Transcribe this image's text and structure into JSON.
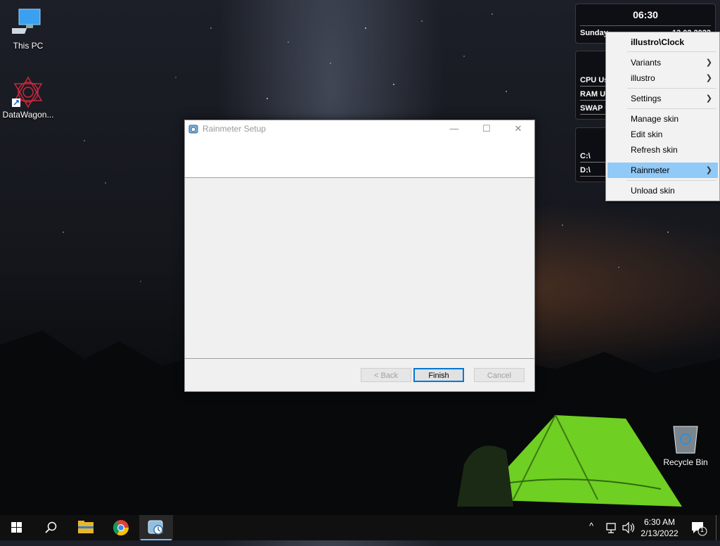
{
  "desktop": {
    "icons": [
      {
        "label": "This PC"
      },
      {
        "label": "DataWagon..."
      },
      {
        "label": "Recycle Bin"
      }
    ]
  },
  "widgets": {
    "clock": {
      "time": "06:30",
      "day": "Sunday",
      "date": "13.02.2022"
    },
    "system": {
      "rows": [
        "CPU Us",
        "RAM Us",
        "SWAP U"
      ]
    },
    "disks": {
      "rows": [
        "C:\\",
        "D:\\"
      ]
    }
  },
  "context_menu": {
    "header": "illustro\\Clock",
    "items": {
      "variants": "Variants",
      "illustro": "illustro",
      "settings": "Settings",
      "manage_skin": "Manage skin",
      "edit_skin": "Edit skin",
      "refresh_skin": "Refresh skin",
      "rainmeter": "Rainmeter",
      "unload_skin": "Unload skin"
    },
    "highlighted": "Rainmeter",
    "highlight_color": "#91c9f7"
  },
  "setup_window": {
    "title": "Rainmeter Setup",
    "buttons": {
      "back": "< Back",
      "finish": "Finish",
      "cancel": "Cancel"
    },
    "minimize_glyph": "—",
    "maximize_glyph": "☐",
    "close_glyph": "✕"
  },
  "taskbar": {
    "apps": [
      "start-icon",
      "search-icon",
      "file-explorer-icon",
      "chrome-icon",
      "rainmeter-setup-icon"
    ],
    "tray": {
      "chevron": "^",
      "time": "6:30 AM",
      "date": "2/13/2022",
      "notifications": "1"
    },
    "accent": "#76b9ed"
  }
}
